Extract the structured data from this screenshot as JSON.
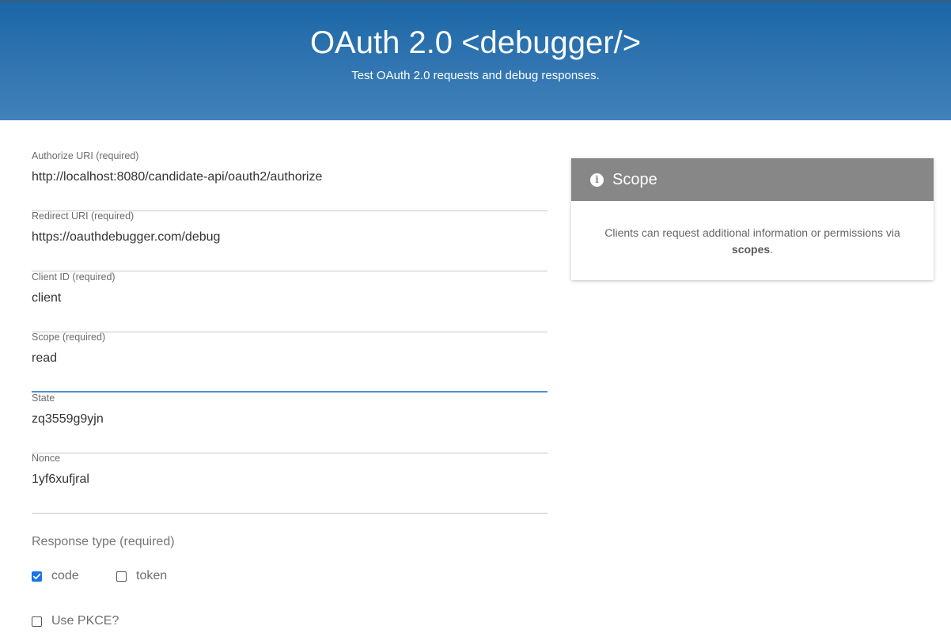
{
  "header": {
    "title_main": "OAuth 2.0",
    "title_tag": "<debugger/>",
    "subtitle": "Test OAuth 2.0 requests and debug responses."
  },
  "form": {
    "fields": [
      {
        "label": "Authorize URI (required)",
        "value": "http://localhost:8080/candidate-api/oauth2/authorize"
      },
      {
        "label": "Redirect URI (required)",
        "value": "https://oauthdebugger.com/debug"
      },
      {
        "label": "Client ID (required)",
        "value": "client"
      },
      {
        "label": "Scope (required)",
        "value": "read"
      },
      {
        "label": "State",
        "value": "zq3559g9yjn"
      },
      {
        "label": "Nonce",
        "value": "1yf6xufjral"
      }
    ],
    "response_type_label": "Response type (required)",
    "response_types": [
      {
        "label": "code",
        "checked": true
      },
      {
        "label": "token",
        "checked": false
      }
    ],
    "pkce": {
      "label": "Use PKCE?",
      "checked": false
    }
  },
  "info_card": {
    "icon": "info-icon",
    "title": "Scope",
    "body_text": "Clients can request additional information or permissions via",
    "body_bold": "scopes",
    "body_end": "."
  },
  "colors": {
    "header_top": "#1b66a6",
    "header_bottom": "#4281ba",
    "focus_underline": "#4f8fd6",
    "checkbox_checked": "#1a73e8",
    "card_header": "#878787"
  }
}
